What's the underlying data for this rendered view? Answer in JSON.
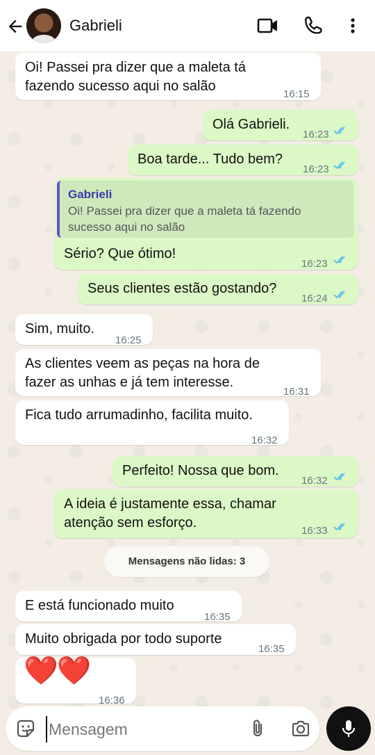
{
  "header": {
    "contact_name": "Gabrieli"
  },
  "messages": [
    {
      "dir": "in",
      "lines": [
        "Oi! Passei pra dizer que a maleta tá",
        "fazendo sucesso aqui no salão"
      ],
      "time": "16:15"
    },
    {
      "dir": "out",
      "lines": [
        "Olá Gabrieli."
      ],
      "time": "16:23"
    },
    {
      "dir": "out",
      "lines": [
        "Boa tarde... Tudo bem?"
      ],
      "time": "16:23"
    },
    {
      "dir": "out",
      "reply_to": {
        "name": "Gabrieli",
        "text": "Oi! Passei pra dizer que a maleta tá fazendo sucesso aqui no salão"
      },
      "lines": [
        "Sério? Que ótimo!"
      ],
      "time": "16:23"
    },
    {
      "dir": "out",
      "lines": [
        "Seus clientes estão gostando?"
      ],
      "time": "16:24"
    },
    {
      "dir": "in",
      "lines": [
        "Sim, muito."
      ],
      "time": "16:25"
    },
    {
      "dir": "in",
      "lines": [
        "As clientes veem as peças na hora de",
        "fazer as unhas e já tem interesse."
      ],
      "time": "16:31"
    },
    {
      "dir": "in",
      "lines": [
        "Fica tudo arrumadinho, facilita muito."
      ],
      "time": "16:32"
    },
    {
      "dir": "out",
      "lines": [
        "Perfeito! Nossa que bom."
      ],
      "time": "16:32"
    },
    {
      "dir": "out",
      "lines": [
        "A ideia é justamente essa, chamar",
        "atenção sem esforço."
      ],
      "time": "16:33"
    },
    {
      "dir": "in",
      "lines": [
        "E está funcionado muito"
      ],
      "time": "16:35"
    },
    {
      "dir": "in",
      "lines": [
        "Muito obrigada por todo suporte"
      ],
      "time": "16:35"
    },
    {
      "dir": "in",
      "lines": [
        "❤️❤️"
      ],
      "time": "16:36"
    }
  ],
  "unread_label": "Mensagens não lidas: 3",
  "input": {
    "placeholder": "Mensagem"
  },
  "colors": {
    "outgoing": "#dcf8c6",
    "incoming": "#ffffff",
    "read_ticks": "#53bdeb",
    "quote_bar": "#6b4bd6"
  }
}
